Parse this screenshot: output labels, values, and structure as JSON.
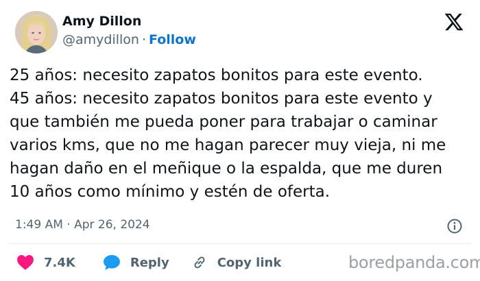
{
  "author": {
    "name": "Amy Dillon",
    "handle": "@amydillon",
    "separator": "·",
    "follow_label": "Follow"
  },
  "tweet": {
    "lines": [
      "25 años: necesito zapatos bonitos para este evento.",
      "45 años: necesito zapatos bonitos para este evento y",
      "que también me pueda poner para trabajar o caminar",
      "varios kms, que no me hagan parecer muy vieja, ni me",
      "hagan daño en el meñique o la espalda, que me duren",
      "10 años como mínimo y estén de oferta."
    ],
    "timestamp": "1:49 AM · Apr 26, 2024"
  },
  "actions": {
    "likes_count": "7.4K",
    "reply_label": "Reply",
    "copy_link_label": "Copy link"
  },
  "watermark": "boredpanda.com",
  "icons": {
    "platform_logo": "x-logo-icon",
    "info": "info-icon",
    "like": "heart-icon",
    "reply": "speech-bubble-icon",
    "copy": "link-icon"
  },
  "colors": {
    "text": "#0f1419",
    "secondary": "#536471",
    "follow": "#0f73c8",
    "heart": "#f91880",
    "reply_bubble": "#1d9bf0",
    "watermark": "#9aa0a6"
  }
}
